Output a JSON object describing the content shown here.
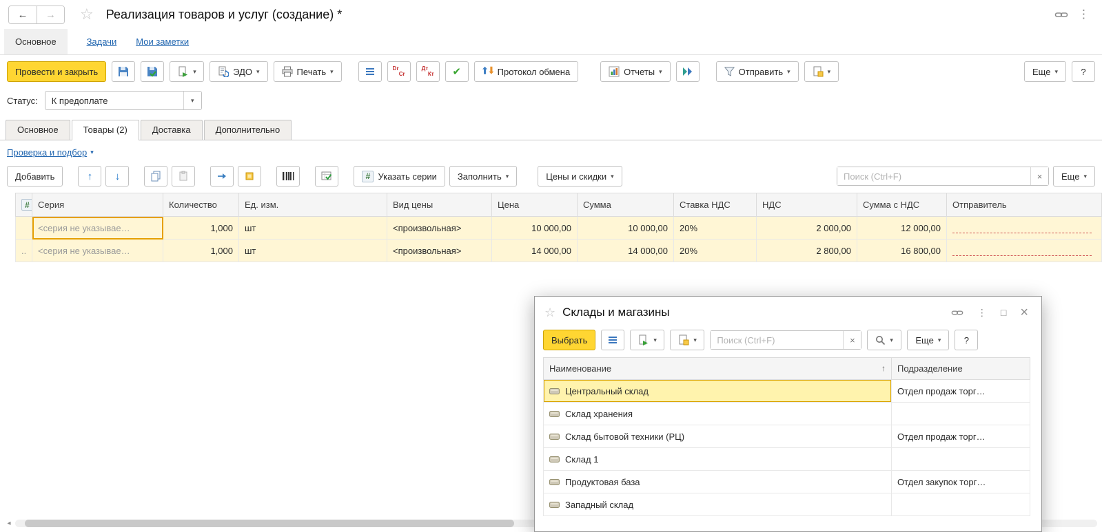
{
  "colors": {
    "accent": "#FFD632",
    "link": "#2166B0",
    "selected_row": "#FFF6D5",
    "focus_border": "#E6A000",
    "required_underline": "#CF5050"
  },
  "icons": {
    "caret": "▾",
    "back": "←",
    "forward": "→",
    "star": "☆",
    "dots": "⋮",
    "close": "×",
    "maximize": "□",
    "up": "↑",
    "down": "↓",
    "check": "✔",
    "sort_asc": "↑",
    "hash": "#",
    "clear": "×",
    "help": "?",
    "scroll_left": "◂",
    "dr_en": "Dr",
    "cr_en": "Cr",
    "dr_ru": "Дт",
    "cr_ru": "Кт"
  },
  "titlebar": {
    "title": "Реализация товаров и услуг (создание) *"
  },
  "nav": {
    "main": "Основное",
    "tasks": "Задачи",
    "notes": "Мои заметки"
  },
  "toolbar": {
    "post_and_close": "Провести и закрыть",
    "edo": "ЭДО",
    "print": "Печать",
    "exchange_protocol": "Протокол обмена",
    "reports": "Отчеты",
    "send": "Отправить",
    "more": "Еще"
  },
  "status": {
    "label": "Статус:",
    "value": "К предоплате"
  },
  "doc_tabs": {
    "main": "Основное",
    "goods": "Товары (2)",
    "delivery": "Доставка",
    "additional": "Дополнительно"
  },
  "links": {
    "check_and_pick": "Проверка и подбор"
  },
  "table_toolbar": {
    "add": "Добавить",
    "set_series": "Указать серии",
    "fill": "Заполнить",
    "prices_discounts": "Цены и скидки",
    "search_placeholder": "Поиск (Ctrl+F)",
    "more": "Еще"
  },
  "goods_table": {
    "columns": {
      "series": "Серия",
      "qty": "Количество",
      "unit": "Ед. изм.",
      "price_type": "Вид цены",
      "price": "Цена",
      "amount": "Сумма",
      "vat_rate": "Ставка НДС",
      "vat": "НДС",
      "total": "Сумма с НДС",
      "sender": "Отправитель"
    },
    "rows": [
      {
        "marker": "",
        "series": "<серия не указывае…",
        "qty": "1,000",
        "unit": "шт",
        "price_type": "<произвольная>",
        "price": "10 000,00",
        "amount": "10 000,00",
        "vat_rate": "20%",
        "vat": "2 000,00",
        "total": "12 000,00"
      },
      {
        "marker": "..",
        "series": "<серия не указывае…",
        "qty": "1,000",
        "unit": "шт",
        "price_type": "<произвольная>",
        "price": "14 000,00",
        "amount": "14 000,00",
        "vat_rate": "20%",
        "vat": "2 800,00",
        "total": "16 800,00"
      }
    ]
  },
  "dialog": {
    "title": "Склады и магазины",
    "select": "Выбрать",
    "search_placeholder": "Поиск (Ctrl+F)",
    "more": "Еще",
    "columns": {
      "name": "Наименование",
      "division": "Подразделение"
    },
    "rows": [
      {
        "name": "Центральный склад",
        "division": "Отдел продаж торг…"
      },
      {
        "name": "Склад хранения",
        "division": ""
      },
      {
        "name": "Склад бытовой техники (РЦ)",
        "division": "Отдел продаж торг…"
      },
      {
        "name": "Склад 1",
        "division": ""
      },
      {
        "name": "Продуктовая база",
        "division": "Отдел закупок торг…"
      },
      {
        "name": "Западный склад",
        "division": ""
      }
    ]
  }
}
